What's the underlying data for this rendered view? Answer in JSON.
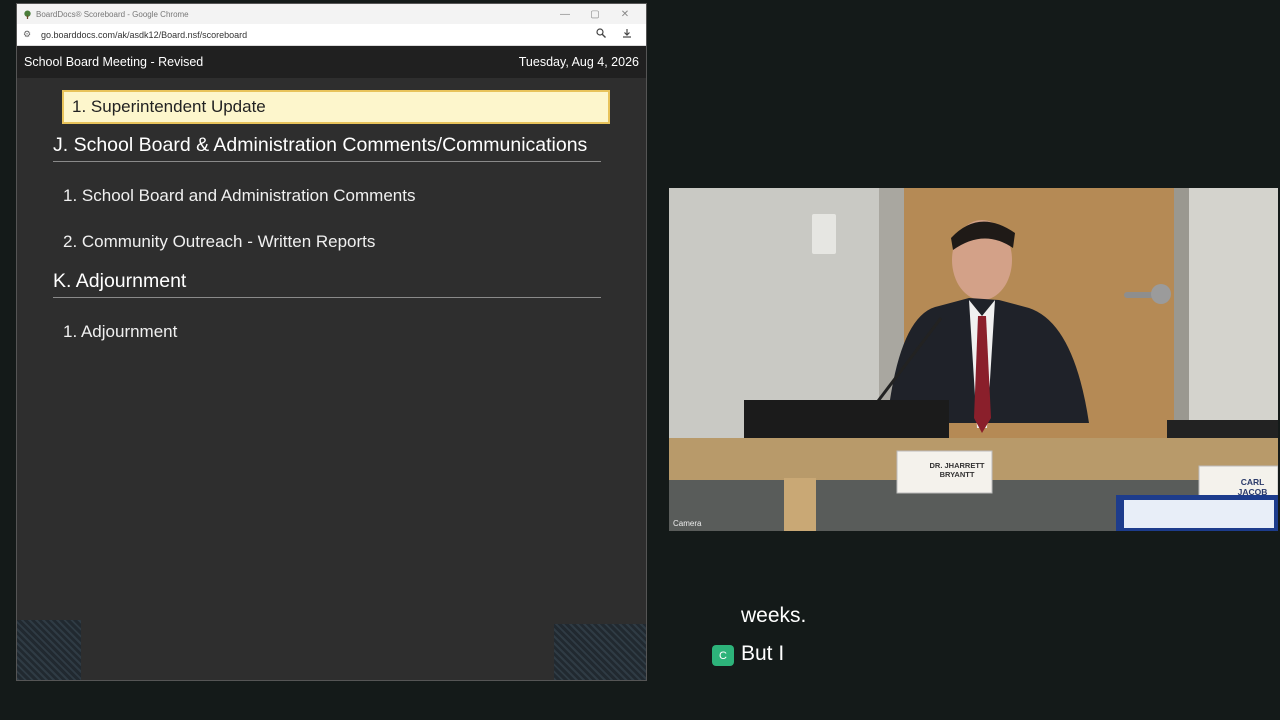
{
  "browser": {
    "title": "BoardDocs® Scoreboard - Google Chrome",
    "url": "go.boarddocs.com/ak/asdk12/Board.nsf/scoreboard",
    "controls": {
      "minimize": "—",
      "maximize": "▢",
      "close": "✕"
    }
  },
  "board": {
    "meeting_title": "School Board Meeting - Revised",
    "date": "Tuesday, Aug 4, 2026",
    "active_item": "1. Superintendent Update",
    "sections": [
      {
        "heading": "J. School Board & Administration Comments/Communications",
        "items": [
          "1. School Board and Administration Comments",
          "2. Community Outreach - Written Reports"
        ]
      },
      {
        "heading": "K. Adjournment",
        "items": [
          "1. Adjournment"
        ]
      }
    ]
  },
  "camera": {
    "label": "Camera",
    "nameplate_1_line1": "DR. JHARRETT",
    "nameplate_1_line2": "BRYANTT",
    "nameplate_2_line1": "CARL",
    "nameplate_2_line2": "JACOB"
  },
  "captions": {
    "line1": "weeks.",
    "line2": "But I",
    "cc_icon": "C"
  },
  "colors": {
    "active_bg": "#fdf6cc",
    "active_border": "#e8c35b",
    "caption_icon": "#2db37a"
  }
}
